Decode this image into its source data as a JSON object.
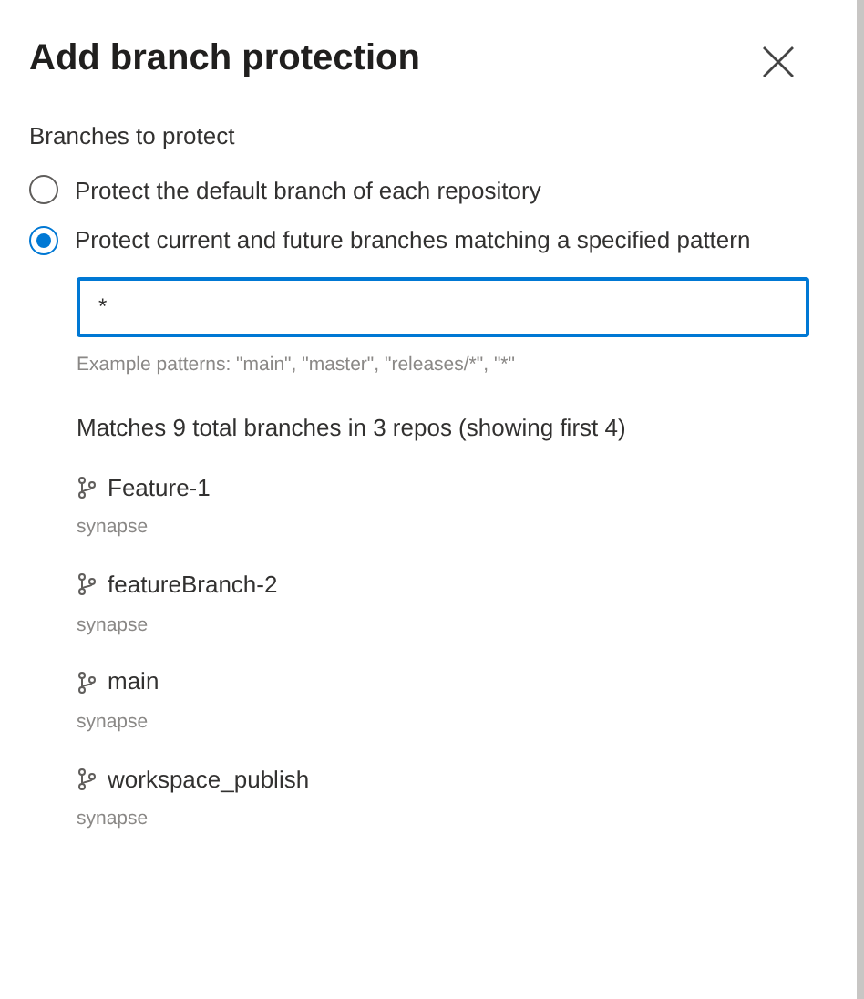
{
  "dialog": {
    "title": "Add branch protection"
  },
  "section_label": "Branches to protect",
  "options": [
    {
      "label": "Protect the default branch of each repository",
      "selected": false
    },
    {
      "label": "Protect current and future branches matching a specified pattern",
      "selected": true
    }
  ],
  "pattern_field": {
    "value": "*"
  },
  "hint": "Example patterns: \"main\", \"master\", \"releases/*\", \"*\"",
  "matches_summary": "Matches 9 total branches in 3 repos (showing first 4)",
  "branches": [
    {
      "name": "Feature-1",
      "repo": "synapse"
    },
    {
      "name": "featureBranch-2",
      "repo": "synapse"
    },
    {
      "name": "main",
      "repo": "synapse"
    },
    {
      "name": "workspace_publish",
      "repo": "synapse"
    }
  ]
}
